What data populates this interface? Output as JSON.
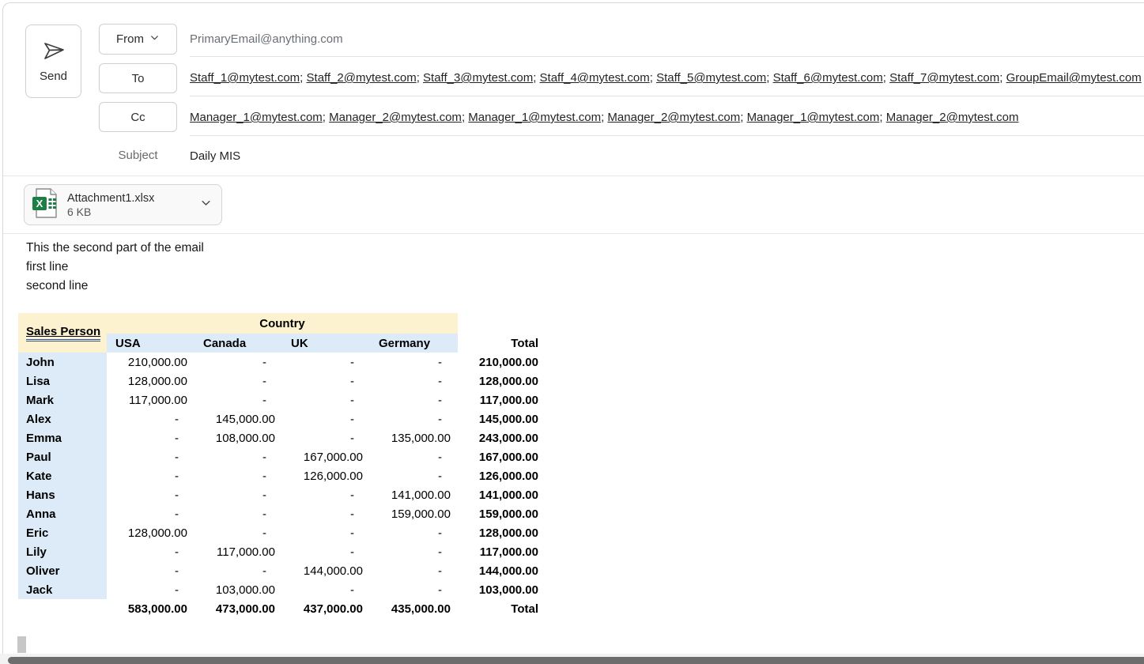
{
  "compose": {
    "send_label": "Send",
    "from_label": "From",
    "to_label": "To",
    "cc_label": "Cc",
    "subject_label": "Subject",
    "from_value": "PrimaryEmail@anything.com",
    "to_recipients": [
      "Staff_1@mytest.com",
      "Staff_2@mytest.com",
      "Staff_3@mytest.com",
      "Staff_4@mytest.com",
      "Staff_5@mytest.com",
      "Staff_6@mytest.com",
      "Staff_7@mytest.com",
      "GroupEmail@mytest.com"
    ],
    "cc_recipients": [
      "Manager_1@mytest.com",
      "Manager_2@mytest.com",
      "Manager_1@mytest.com",
      "Manager_2@mytest.com",
      "Manager_1@mytest.com",
      "Manager_2@mytest.com"
    ],
    "subject_value": "Daily MIS"
  },
  "attachment": {
    "filename": "Attachment1.xlsx",
    "size": "6 KB",
    "file_icon": "excel-file-icon",
    "expand_icon": "chevron-down-icon"
  },
  "body": {
    "lines": [
      "This the second part of the email",
      "first line",
      "second line"
    ]
  },
  "table": {
    "corner_header": "Sales Person",
    "group_header": "Country",
    "columns": [
      "USA",
      "Canada",
      "UK",
      "Germany"
    ],
    "total_header": "Total",
    "rows": [
      {
        "name": "John",
        "values": [
          "210,000.00",
          "-",
          "-",
          "-"
        ],
        "total": "210,000.00"
      },
      {
        "name": "Lisa",
        "values": [
          "128,000.00",
          "-",
          "-",
          "-"
        ],
        "total": "128,000.00"
      },
      {
        "name": "Mark",
        "values": [
          "117,000.00",
          "-",
          "-",
          "-"
        ],
        "total": "117,000.00"
      },
      {
        "name": "Alex",
        "values": [
          "-",
          "145,000.00",
          "-",
          "-"
        ],
        "total": "145,000.00"
      },
      {
        "name": "Emma",
        "values": [
          "-",
          "108,000.00",
          "-",
          "135,000.00"
        ],
        "total": "243,000.00"
      },
      {
        "name": "Paul",
        "values": [
          "-",
          "-",
          "167,000.00",
          "-"
        ],
        "total": "167,000.00"
      },
      {
        "name": "Kate",
        "values": [
          "-",
          "-",
          "126,000.00",
          "-"
        ],
        "total": "126,000.00"
      },
      {
        "name": "Hans",
        "values": [
          "-",
          "-",
          "-",
          "141,000.00"
        ],
        "total": "141,000.00"
      },
      {
        "name": "Anna",
        "values": [
          "-",
          "-",
          "-",
          "159,000.00"
        ],
        "total": "159,000.00"
      },
      {
        "name": "Eric",
        "values": [
          "128,000.00",
          "-",
          "-",
          "-"
        ],
        "total": "128,000.00"
      },
      {
        "name": "Lily",
        "values": [
          "-",
          "117,000.00",
          "-",
          "-"
        ],
        "total": "117,000.00"
      },
      {
        "name": "Oliver",
        "values": [
          "-",
          "-",
          "144,000.00",
          "-"
        ],
        "total": "144,000.00"
      },
      {
        "name": "Jack",
        "values": [
          "-",
          "103,000.00",
          "-",
          "-"
        ],
        "total": "103,000.00"
      }
    ],
    "footer": {
      "values": [
        "583,000.00",
        "473,000.00",
        "437,000.00",
        "435,000.00"
      ],
      "label": "Total"
    }
  },
  "icons": {
    "send": "paper-plane-icon",
    "from_dropdown": "chevron-down-icon"
  },
  "colors": {
    "header_cream": "#fdf2d0",
    "header_blue": "#dcebf7",
    "excel_green": "#1d7e46",
    "sales_person_underline": "#2f5597"
  }
}
